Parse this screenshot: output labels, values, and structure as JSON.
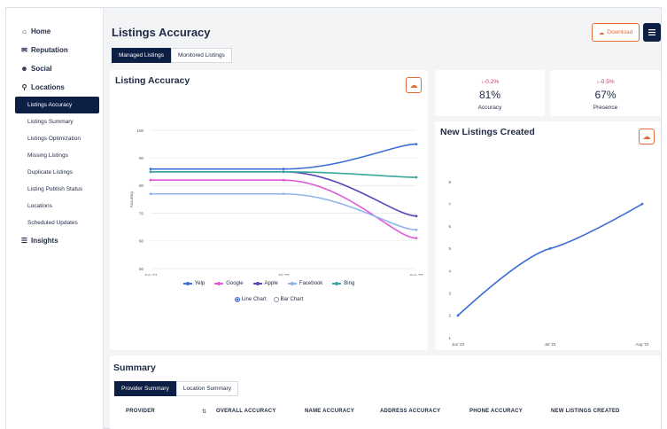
{
  "sidebar": {
    "main_items": [
      {
        "label": "Home",
        "icon": "home-icon"
      },
      {
        "label": "Reputation",
        "icon": "reputation-icon"
      },
      {
        "label": "Social",
        "icon": "social-icon"
      },
      {
        "label": "Locations",
        "icon": "location-pin-icon"
      },
      {
        "label": "Insights",
        "icon": "insights-icon"
      }
    ],
    "sub_items": [
      {
        "label": "Listings Accuracy",
        "active": true
      },
      {
        "label": "Listings Summary"
      },
      {
        "label": "Listings Optimization"
      },
      {
        "label": "Missing Listings"
      },
      {
        "label": "Duplicate Listings"
      },
      {
        "label": "Listing Publish Status"
      },
      {
        "label": "Locations"
      },
      {
        "label": "Scheduled Updates"
      }
    ]
  },
  "header": {
    "title": "Listings Accuracy",
    "download_label": "Download"
  },
  "top_tabs": [
    {
      "label": "Managed Listings",
      "active": true
    },
    {
      "label": "Monitored Listings",
      "active": false
    }
  ],
  "stats": [
    {
      "change": "-0.2%",
      "value": "81%",
      "label": "Accuracy"
    },
    {
      "change": "-0.5%",
      "value": "67%",
      "label": "Presence"
    }
  ],
  "accuracy_card": {
    "title": "Listing Accuracy",
    "radio_options": [
      {
        "label": "Line Chart",
        "selected": true
      },
      {
        "label": "Bar Chart",
        "selected": false
      }
    ]
  },
  "new_listings_card": {
    "title": "New Listings Created"
  },
  "summary": {
    "title": "Summary",
    "tabs": [
      {
        "label": "Provider Summary",
        "active": true
      },
      {
        "label": "Location Summary",
        "active": false
      }
    ],
    "columns": [
      "PROVIDER",
      "OVERALL ACCURACY",
      "NAME ACCURACY",
      "ADDRESS ACCURACY",
      "PHONE ACCURACY",
      "NEW LISTINGS CREATED"
    ]
  },
  "colors": {
    "navy": "#0d1f45",
    "accent_orange": "#e06d3a",
    "negative": "#d6336c"
  },
  "chart_data": [
    {
      "type": "line",
      "title": "Listing Accuracy",
      "ylabel": "Accuracy",
      "xlabel": "",
      "x": [
        "Jun '23",
        "Jul '23",
        "Aug '23"
      ],
      "ylim": [
        50,
        100
      ],
      "yticks": [
        50,
        60,
        70,
        80,
        90,
        100
      ],
      "grid": true,
      "legend": "bottom",
      "series": [
        {
          "name": "Yelp",
          "color": "#3b6fd6",
          "values": [
            86,
            86,
            95
          ]
        },
        {
          "name": "Google",
          "color": "#e05ad8",
          "values": [
            82,
            82,
            61
          ]
        },
        {
          "name": "Apple",
          "color": "#5a44b8",
          "values": [
            85,
            85,
            69
          ]
        },
        {
          "name": "Facebook",
          "color": "#8fb4ec",
          "values": [
            77,
            77,
            64
          ]
        },
        {
          "name": "Bing",
          "color": "#3aa6a0",
          "values": [
            85,
            85,
            83
          ]
        }
      ]
    },
    {
      "type": "line",
      "title": "New Listings Created",
      "xlabel": "",
      "ylabel": "",
      "x": [
        "Jun '23",
        "Jul '23",
        "Aug '23"
      ],
      "ylim": [
        1,
        8
      ],
      "yticks": [
        1,
        2,
        3,
        4,
        5,
        6,
        7,
        8
      ],
      "grid": false,
      "series": [
        {
          "color": "#3b6fd6",
          "values": [
            2,
            5,
            7
          ]
        }
      ]
    }
  ]
}
